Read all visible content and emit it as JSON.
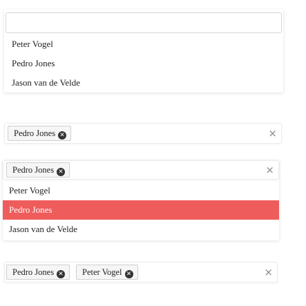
{
  "dropdown1": {
    "search_value": "",
    "options": [
      "Peter Vogel",
      "Pedro Jones",
      "Jason van de Velde"
    ]
  },
  "select2": {
    "tags": [
      "Pedro Jones"
    ],
    "clear_glyph": "×"
  },
  "dropdown2": {
    "tags": [
      "Pedro Jones"
    ],
    "clear_glyph": "×",
    "options": [
      "Peter Vogel",
      "Pedro Jones",
      "Jason van de Velde"
    ],
    "highlighted_option": "Pedro Jones"
  },
  "select4": {
    "tags": [
      "Pedro Jones",
      "Peter Vogel"
    ],
    "clear_glyph": "×"
  },
  "colors": {
    "highlight": "#ef5c5c",
    "tag_bg": "#f6f6f6",
    "tag_border": "#cfcfcf"
  },
  "icons": {
    "tag_remove": "close-circle-icon",
    "clear": "clear-icon"
  }
}
